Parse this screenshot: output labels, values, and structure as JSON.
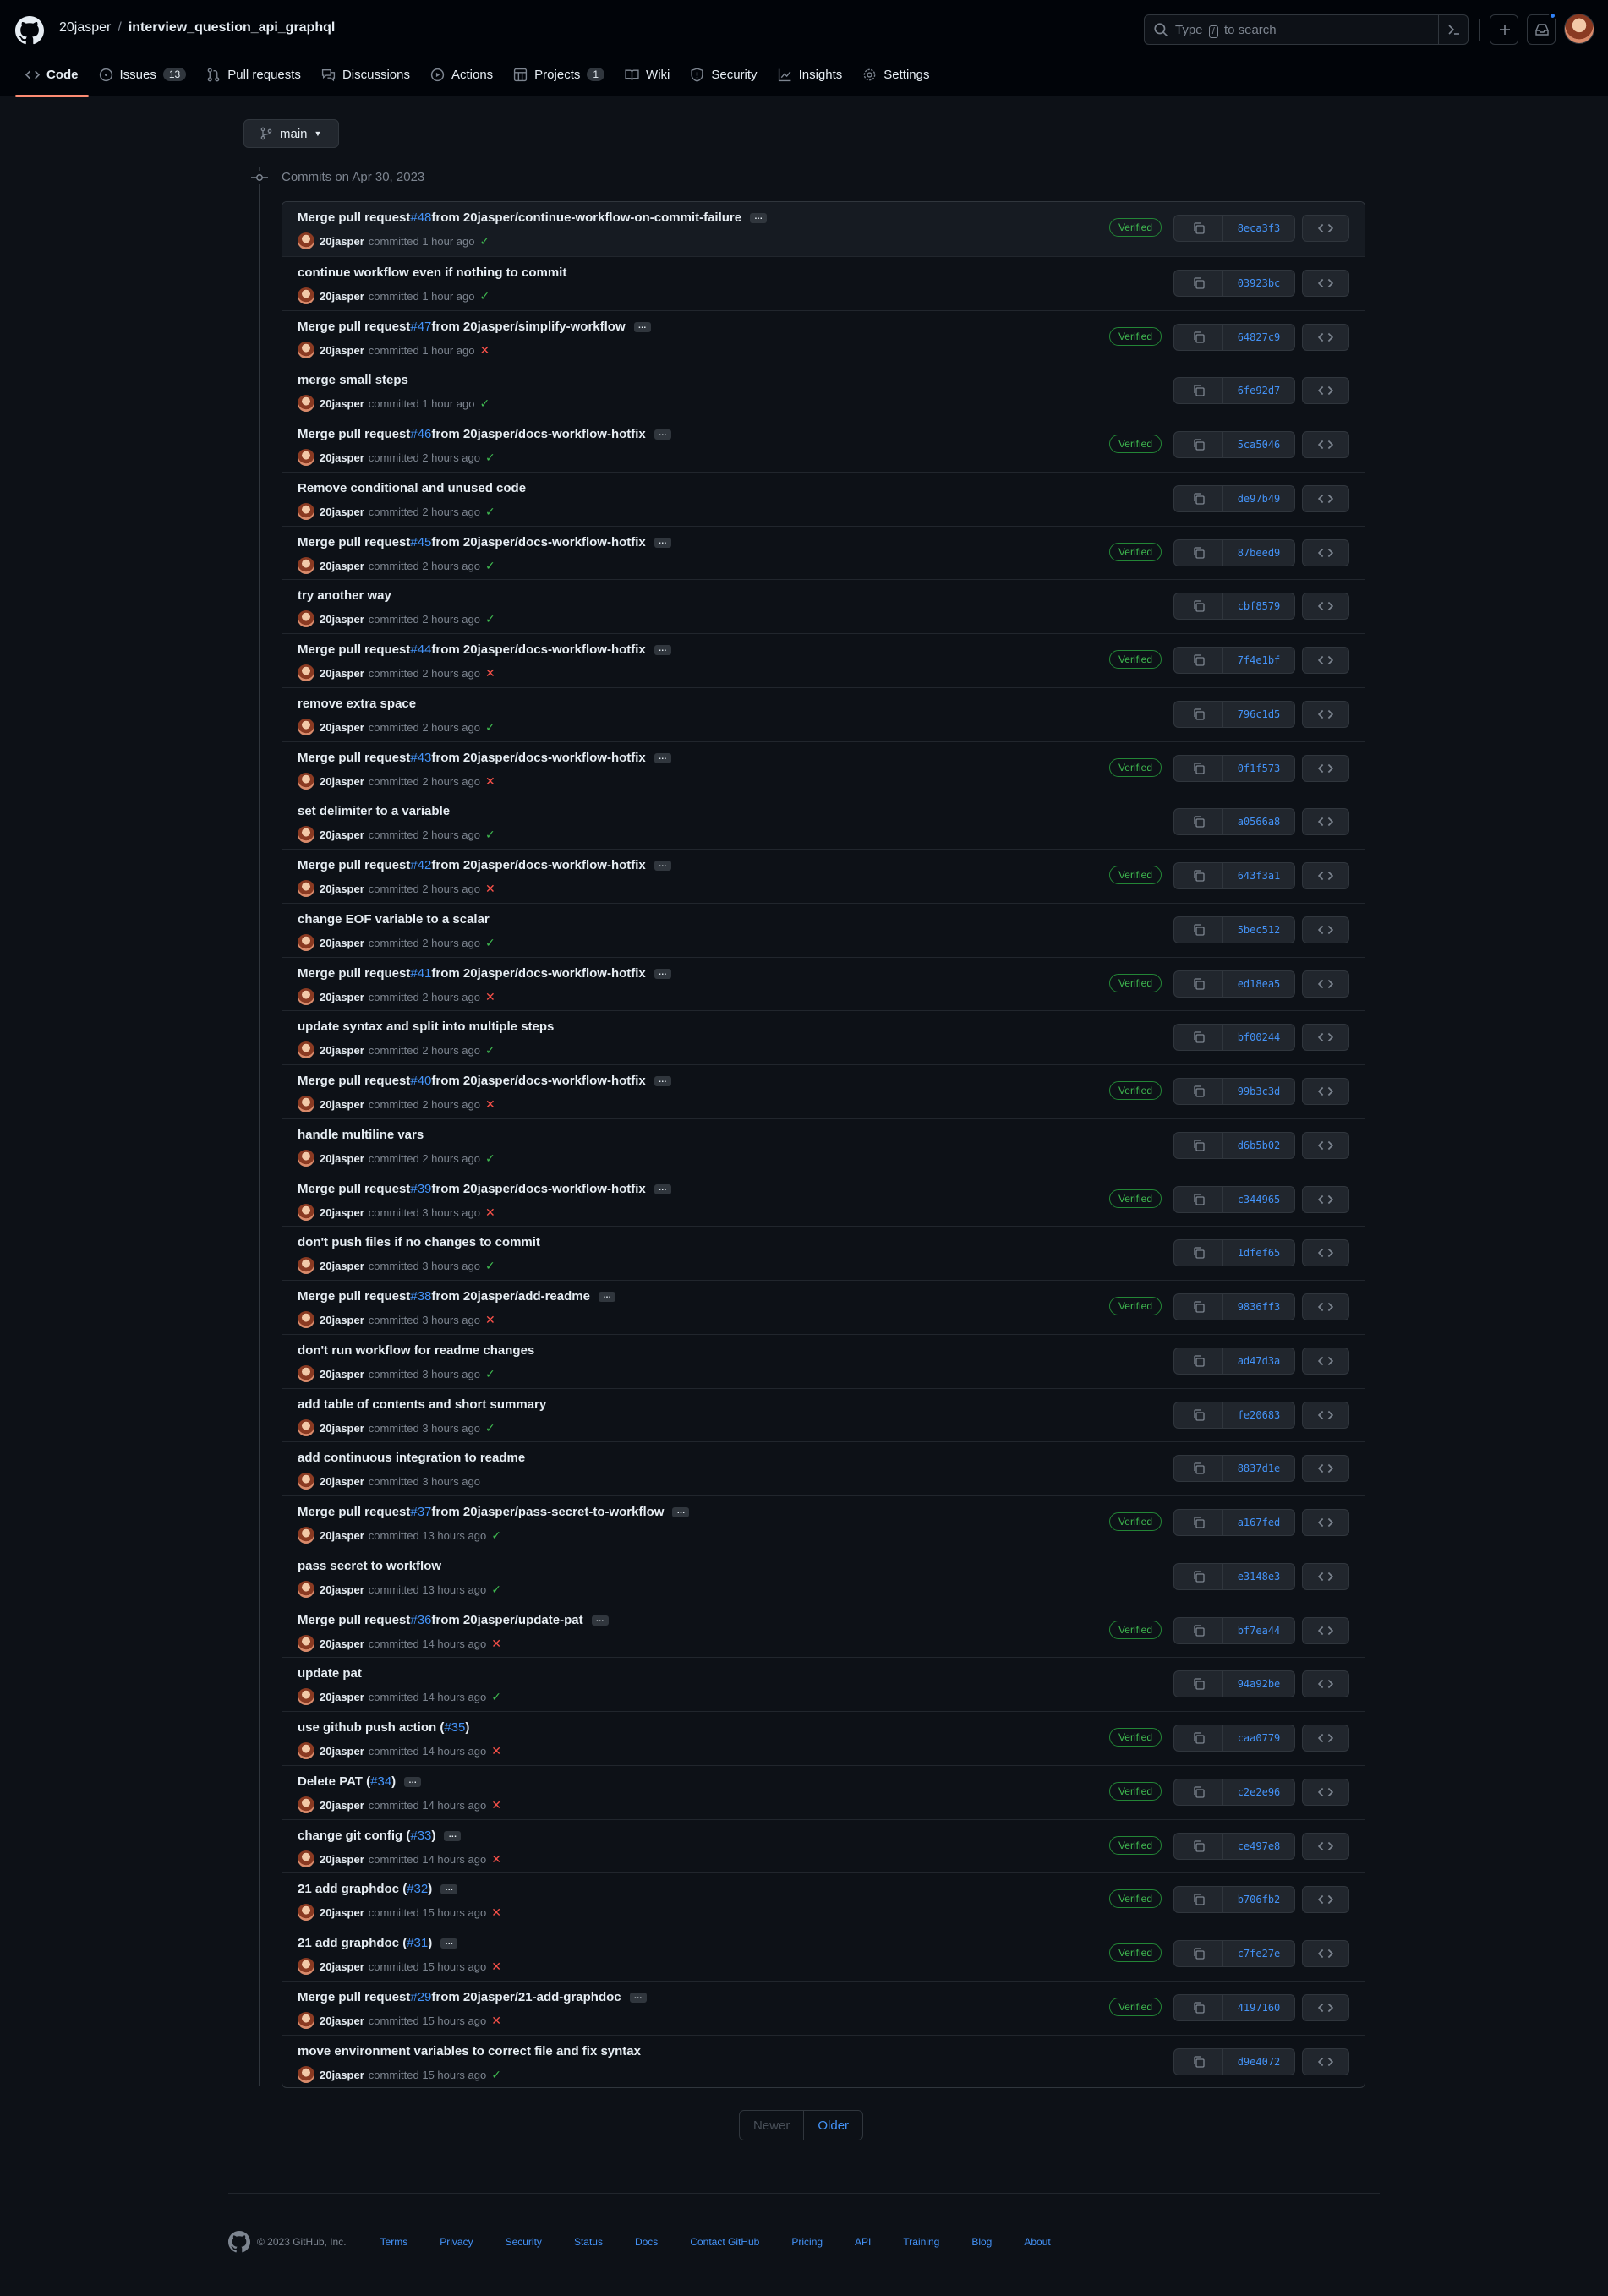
{
  "header": {
    "owner": "20jasper",
    "repo": "interview_question_api_graphql",
    "search_prefix": "Type",
    "search_key": "/",
    "search_suffix": "to search"
  },
  "tabs": [
    {
      "label": "Code",
      "icon": "code-icon"
    },
    {
      "label": "Issues",
      "icon": "issue-icon",
      "count": "13"
    },
    {
      "label": "Pull requests",
      "icon": "pull-request-icon"
    },
    {
      "label": "Discussions",
      "icon": "discussions-icon"
    },
    {
      "label": "Actions",
      "icon": "actions-icon"
    },
    {
      "label": "Projects",
      "icon": "projects-icon",
      "count": "1"
    },
    {
      "label": "Wiki",
      "icon": "wiki-icon"
    },
    {
      "label": "Security",
      "icon": "shield-icon"
    },
    {
      "label": "Insights",
      "icon": "graph-icon"
    },
    {
      "label": "Settings",
      "icon": "gear-icon"
    }
  ],
  "branch": {
    "name": "main"
  },
  "commit_group": {
    "date_label": "Commits on Apr 30, 2023"
  },
  "commits": [
    {
      "pre": "Merge pull request ",
      "pr": "#48",
      "post": " from 20jasper/continue-workflow-on-commit-failure",
      "more": true,
      "author": "20jasper",
      "time": "committed 1 hour ago",
      "status": "ok",
      "verified": true,
      "sha": "8eca3f3"
    },
    {
      "pre": "continue workflow even if nothing to commit",
      "pr": "",
      "post": "",
      "more": false,
      "author": "20jasper",
      "time": "committed 1 hour ago",
      "status": "ok",
      "verified": false,
      "sha": "03923bc"
    },
    {
      "pre": "Merge pull request ",
      "pr": "#47",
      "post": " from 20jasper/simplify-workflow",
      "more": true,
      "author": "20jasper",
      "time": "committed 1 hour ago",
      "status": "fail",
      "verified": true,
      "sha": "64827c9"
    },
    {
      "pre": "merge small steps",
      "pr": "",
      "post": "",
      "more": false,
      "author": "20jasper",
      "time": "committed 1 hour ago",
      "status": "ok",
      "verified": false,
      "sha": "6fe92d7"
    },
    {
      "pre": "Merge pull request ",
      "pr": "#46",
      "post": " from 20jasper/docs-workflow-hotfix",
      "more": true,
      "author": "20jasper",
      "time": "committed 2 hours ago",
      "status": "ok",
      "verified": true,
      "sha": "5ca5046"
    },
    {
      "pre": "Remove conditional and unused code",
      "pr": "",
      "post": "",
      "more": false,
      "author": "20jasper",
      "time": "committed 2 hours ago",
      "status": "ok",
      "verified": false,
      "sha": "de97b49"
    },
    {
      "pre": "Merge pull request ",
      "pr": "#45",
      "post": " from 20jasper/docs-workflow-hotfix",
      "more": true,
      "author": "20jasper",
      "time": "committed 2 hours ago",
      "status": "ok",
      "verified": true,
      "sha": "87beed9"
    },
    {
      "pre": "try another way",
      "pr": "",
      "post": "",
      "more": false,
      "author": "20jasper",
      "time": "committed 2 hours ago",
      "status": "ok",
      "verified": false,
      "sha": "cbf8579"
    },
    {
      "pre": "Merge pull request ",
      "pr": "#44",
      "post": " from 20jasper/docs-workflow-hotfix",
      "more": true,
      "author": "20jasper",
      "time": "committed 2 hours ago",
      "status": "fail",
      "verified": true,
      "sha": "7f4e1bf"
    },
    {
      "pre": "remove extra space",
      "pr": "",
      "post": "",
      "more": false,
      "author": "20jasper",
      "time": "committed 2 hours ago",
      "status": "ok",
      "verified": false,
      "sha": "796c1d5"
    },
    {
      "pre": "Merge pull request ",
      "pr": "#43",
      "post": " from 20jasper/docs-workflow-hotfix",
      "more": true,
      "author": "20jasper",
      "time": "committed 2 hours ago",
      "status": "fail",
      "verified": true,
      "sha": "0f1f573"
    },
    {
      "pre": "set delimiter to a variable",
      "pr": "",
      "post": "",
      "more": false,
      "author": "20jasper",
      "time": "committed 2 hours ago",
      "status": "ok",
      "verified": false,
      "sha": "a0566a8"
    },
    {
      "pre": "Merge pull request ",
      "pr": "#42",
      "post": " from 20jasper/docs-workflow-hotfix",
      "more": true,
      "author": "20jasper",
      "time": "committed 2 hours ago",
      "status": "fail",
      "verified": true,
      "sha": "643f3a1"
    },
    {
      "pre": "change EOF variable to a scalar",
      "pr": "",
      "post": "",
      "more": false,
      "author": "20jasper",
      "time": "committed 2 hours ago",
      "status": "ok",
      "verified": false,
      "sha": "5bec512"
    },
    {
      "pre": "Merge pull request ",
      "pr": "#41",
      "post": " from 20jasper/docs-workflow-hotfix",
      "more": true,
      "author": "20jasper",
      "time": "committed 2 hours ago",
      "status": "fail",
      "verified": true,
      "sha": "ed18ea5"
    },
    {
      "pre": "update syntax and split into multiple steps",
      "pr": "",
      "post": "",
      "more": false,
      "author": "20jasper",
      "time": "committed 2 hours ago",
      "status": "ok",
      "verified": false,
      "sha": "bf00244"
    },
    {
      "pre": "Merge pull request ",
      "pr": "#40",
      "post": " from 20jasper/docs-workflow-hotfix",
      "more": true,
      "author": "20jasper",
      "time": "committed 2 hours ago",
      "status": "fail",
      "verified": true,
      "sha": "99b3c3d"
    },
    {
      "pre": "handle multiline vars",
      "pr": "",
      "post": "",
      "more": false,
      "author": "20jasper",
      "time": "committed 2 hours ago",
      "status": "ok",
      "verified": false,
      "sha": "d6b5b02"
    },
    {
      "pre": "Merge pull request ",
      "pr": "#39",
      "post": " from 20jasper/docs-workflow-hotfix",
      "more": true,
      "author": "20jasper",
      "time": "committed 3 hours ago",
      "status": "fail",
      "verified": true,
      "sha": "c344965"
    },
    {
      "pre": "don't push files if no changes to commit",
      "pr": "",
      "post": "",
      "more": false,
      "author": "20jasper",
      "time": "committed 3 hours ago",
      "status": "ok",
      "verified": false,
      "sha": "1dfef65"
    },
    {
      "pre": "Merge pull request ",
      "pr": "#38",
      "post": " from 20jasper/add-readme",
      "more": true,
      "author": "20jasper",
      "time": "committed 3 hours ago",
      "status": "fail",
      "verified": true,
      "sha": "9836ff3"
    },
    {
      "pre": "don't run workflow for readme changes",
      "pr": "",
      "post": "",
      "more": false,
      "author": "20jasper",
      "time": "committed 3 hours ago",
      "status": "ok",
      "verified": false,
      "sha": "ad47d3a"
    },
    {
      "pre": "add table of contents and short summary",
      "pr": "",
      "post": "",
      "more": false,
      "author": "20jasper",
      "time": "committed 3 hours ago",
      "status": "ok",
      "verified": false,
      "sha": "fe20683"
    },
    {
      "pre": "add continuous integration to readme",
      "pr": "",
      "post": "",
      "more": false,
      "author": "20jasper",
      "time": "committed 3 hours ago",
      "status": "",
      "verified": false,
      "sha": "8837d1e"
    },
    {
      "pre": "Merge pull request ",
      "pr": "#37",
      "post": " from 20jasper/pass-secret-to-workflow",
      "more": true,
      "author": "20jasper",
      "time": "committed 13 hours ago",
      "status": "ok",
      "verified": true,
      "sha": "a167fed"
    },
    {
      "pre": "pass secret to workflow",
      "pr": "",
      "post": "",
      "more": false,
      "author": "20jasper",
      "time": "committed 13 hours ago",
      "status": "ok",
      "verified": false,
      "sha": "e3148e3"
    },
    {
      "pre": "Merge pull request ",
      "pr": "#36",
      "post": " from 20jasper/update-pat",
      "more": true,
      "author": "20jasper",
      "time": "committed 14 hours ago",
      "status": "fail",
      "verified": true,
      "sha": "bf7ea44"
    },
    {
      "pre": "update pat",
      "pr": "",
      "post": "",
      "more": false,
      "author": "20jasper",
      "time": "committed 14 hours ago",
      "status": "ok",
      "verified": false,
      "sha": "94a92be"
    },
    {
      "pre": "use github push action (",
      "pr": "#35",
      "post": ")",
      "more": false,
      "author": "20jasper",
      "time": "committed 14 hours ago",
      "status": "fail",
      "verified": true,
      "sha": "caa0779"
    },
    {
      "pre": "Delete PAT (",
      "pr": "#34",
      "post": ")",
      "more": true,
      "author": "20jasper",
      "time": "committed 14 hours ago",
      "status": "fail",
      "verified": true,
      "sha": "c2e2e96"
    },
    {
      "pre": "change git config (",
      "pr": "#33",
      "post": ")",
      "more": true,
      "author": "20jasper",
      "time": "committed 14 hours ago",
      "status": "fail",
      "verified": true,
      "sha": "ce497e8"
    },
    {
      "pre": "21 add graphdoc (",
      "pr": "#32",
      "post": ")",
      "more": true,
      "author": "20jasper",
      "time": "committed 15 hours ago",
      "status": "fail",
      "verified": true,
      "sha": "b706fb2"
    },
    {
      "pre": "21 add graphdoc (",
      "pr": "#31",
      "post": ")",
      "more": true,
      "author": "20jasper",
      "time": "committed 15 hours ago",
      "status": "fail",
      "verified": true,
      "sha": "c7fe27e"
    },
    {
      "pre": "Merge pull request ",
      "pr": "#29",
      "post": " from 20jasper/21-add-graphdoc",
      "more": true,
      "author": "20jasper",
      "time": "committed 15 hours ago",
      "status": "fail",
      "verified": true,
      "sha": "4197160"
    },
    {
      "pre": "move environment variables to correct file and fix syntax",
      "pr": "",
      "post": "",
      "more": false,
      "author": "20jasper",
      "time": "committed 15 hours ago",
      "status": "ok",
      "verified": false,
      "sha": "d9e4072"
    }
  ],
  "labels": {
    "verified": "Verified",
    "more": "…",
    "ok_mark": "✓",
    "fail_mark": "✕"
  },
  "pagination": {
    "newer": "Newer",
    "older": "Older"
  },
  "footer": {
    "copyright": "© 2023 GitHub, Inc.",
    "links": [
      "Terms",
      "Privacy",
      "Security",
      "Status",
      "Docs",
      "Contact GitHub",
      "Pricing",
      "API",
      "Training",
      "Blog",
      "About"
    ]
  },
  "colors": {
    "background": "#0d1117",
    "link": "#4493f8",
    "success": "#3fb950",
    "danger": "#f85149",
    "tab_underline": "#fd8c73"
  }
}
